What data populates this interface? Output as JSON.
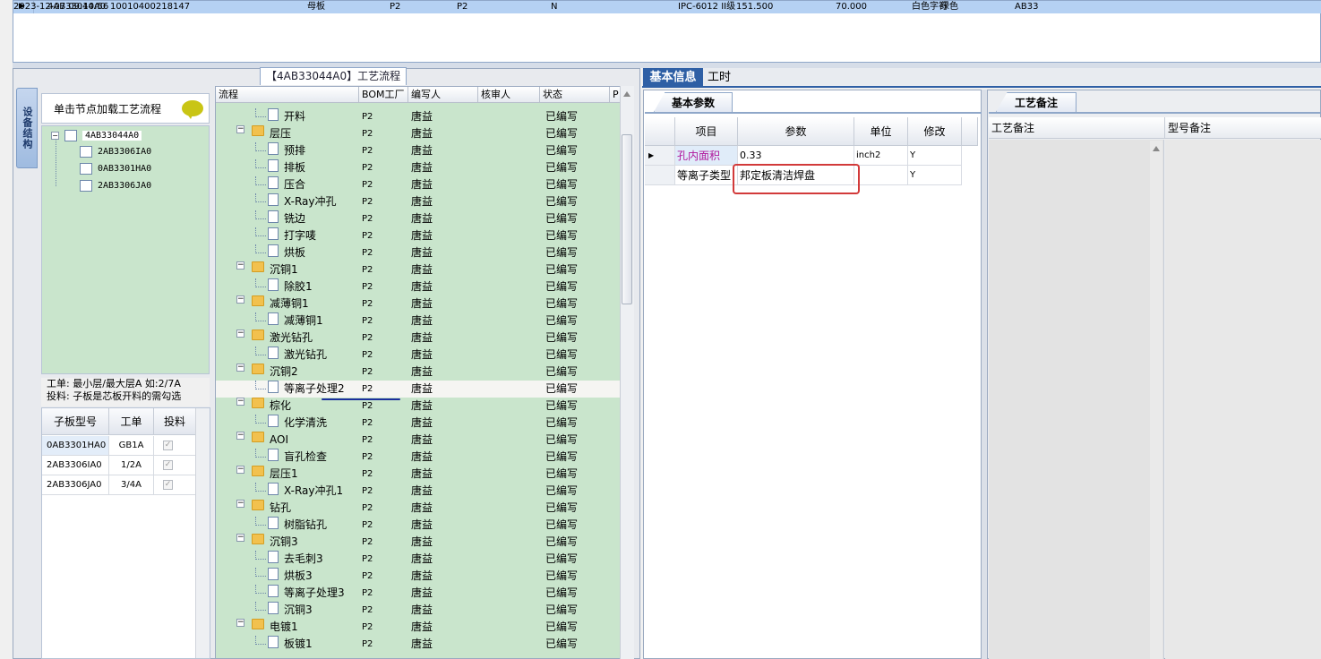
{
  "top_row": {
    "indicator": "▶",
    "cells": [
      "4AB33044A0",
      "10010400218147",
      "母板",
      "P2",
      "P2",
      "N",
      "IPC-6012 II级",
      "151.500",
      "70.000",
      "白色字符",
      "绿色",
      "AB33",
      "2023-12-07 09:10:56"
    ]
  },
  "left_panel": {
    "title": "【4AB33044A0】工艺流程",
    "vertical_tab": "设备结构",
    "tip": "单击节点加载工艺流程",
    "tree": {
      "root": "4AB33044A0",
      "children": [
        "2AB3306IA0",
        "0AB3301HA0",
        "2AB3306JA0"
      ]
    },
    "hint_line1": "工单: 最小层/最大层A 如:2/7A",
    "hint_line2": "投料: 子板是芯板开料的需勾选",
    "subboard_grid": {
      "headers": [
        "子板型号",
        "工单",
        "投料"
      ],
      "rows": [
        {
          "model": "0AB3301HA0",
          "order": "GB1A",
          "feed": true
        },
        {
          "model": "2AB3306IA0",
          "order": "1/2A",
          "feed": true
        },
        {
          "model": "2AB3306JA0",
          "order": "3/4A",
          "feed": true
        }
      ]
    }
  },
  "process_grid": {
    "headers": [
      "流程",
      "BOM工厂",
      "编写人",
      "核审人",
      "状态",
      "P"
    ],
    "rows": [
      {
        "level": 2,
        "name": "开料",
        "bom": "P2",
        "author": "唐益",
        "status": "已编写"
      },
      {
        "level": 1,
        "name": "层压",
        "bom": "P2",
        "author": "唐益",
        "status": "已编写"
      },
      {
        "level": 2,
        "name": "预排",
        "bom": "P2",
        "author": "唐益",
        "status": "已编写"
      },
      {
        "level": 2,
        "name": "排板",
        "bom": "P2",
        "author": "唐益",
        "status": "已编写"
      },
      {
        "level": 2,
        "name": "压合",
        "bom": "P2",
        "author": "唐益",
        "status": "已编写"
      },
      {
        "level": 2,
        "name": "X-Ray冲孔",
        "bom": "P2",
        "author": "唐益",
        "status": "已编写"
      },
      {
        "level": 2,
        "name": "铣边",
        "bom": "P2",
        "author": "唐益",
        "status": "已编写"
      },
      {
        "level": 2,
        "name": "打字唛",
        "bom": "P2",
        "author": "唐益",
        "status": "已编写"
      },
      {
        "level": 2,
        "name": "烘板",
        "bom": "P2",
        "author": "唐益",
        "status": "已编写"
      },
      {
        "level": 1,
        "name": "沉铜1",
        "bom": "P2",
        "author": "唐益",
        "status": "已编写"
      },
      {
        "level": 2,
        "name": "除胶1",
        "bom": "P2",
        "author": "唐益",
        "status": "已编写"
      },
      {
        "level": 1,
        "name": "减薄铜1",
        "bom": "P2",
        "author": "唐益",
        "status": "已编写"
      },
      {
        "level": 2,
        "name": "减薄铜1",
        "bom": "P2",
        "author": "唐益",
        "status": "已编写"
      },
      {
        "level": 1,
        "name": "激光钻孔",
        "bom": "P2",
        "author": "唐益",
        "status": "已编写"
      },
      {
        "level": 2,
        "name": "激光钻孔",
        "bom": "P2",
        "author": "唐益",
        "status": "已编写"
      },
      {
        "level": 1,
        "name": "沉铜2",
        "bom": "P2",
        "author": "唐益",
        "status": "已编写"
      },
      {
        "level": 2,
        "name": "等离子处理2",
        "bom": "P2",
        "author": "唐益",
        "status": "已编写",
        "selected": true
      },
      {
        "level": 1,
        "name": "棕化",
        "bom": "P2",
        "author": "唐益",
        "status": "已编写"
      },
      {
        "level": 2,
        "name": "化学清洗",
        "bom": "P2",
        "author": "唐益",
        "status": "已编写"
      },
      {
        "level": 1,
        "name": "AOI",
        "bom": "P2",
        "author": "唐益",
        "status": "已编写"
      },
      {
        "level": 2,
        "name": "盲孔检查",
        "bom": "P2",
        "author": "唐益",
        "status": "已编写"
      },
      {
        "level": 1,
        "name": "层压1",
        "bom": "P2",
        "author": "唐益",
        "status": "已编写"
      },
      {
        "level": 2,
        "name": "X-Ray冲孔1",
        "bom": "P2",
        "author": "唐益",
        "status": "已编写"
      },
      {
        "level": 1,
        "name": "钻孔",
        "bom": "P2",
        "author": "唐益",
        "status": "已编写"
      },
      {
        "level": 2,
        "name": "树脂钻孔",
        "bom": "P2",
        "author": "唐益",
        "status": "已编写"
      },
      {
        "level": 1,
        "name": "沉铜3",
        "bom": "P2",
        "author": "唐益",
        "status": "已编写"
      },
      {
        "level": 2,
        "name": "去毛刺3",
        "bom": "P2",
        "author": "唐益",
        "status": "已编写"
      },
      {
        "level": 2,
        "name": "烘板3",
        "bom": "P2",
        "author": "唐益",
        "status": "已编写"
      },
      {
        "level": 2,
        "name": "等离子处理3",
        "bom": "P2",
        "author": "唐益",
        "status": "已编写"
      },
      {
        "level": 2,
        "name": "沉铜3",
        "bom": "P2",
        "author": "唐益",
        "status": "已编写"
      },
      {
        "level": 1,
        "name": "电镀1",
        "bom": "P2",
        "author": "唐益",
        "status": "已编写"
      },
      {
        "level": 2,
        "name": "板镀1",
        "bom": "P2",
        "author": "唐益",
        "status": "已编写"
      }
    ]
  },
  "right_tabs": {
    "basic": "基本信息",
    "hours": "工时"
  },
  "params": {
    "tab": "基本参数",
    "headers": [
      "项目",
      "参数",
      "单位",
      "修改"
    ],
    "rows": [
      {
        "item": "孔内面积",
        "value": "0.33",
        "unit": "inch2",
        "modify": "Y",
        "current": true
      },
      {
        "item": "等离子类型",
        "value": "邦定板清洁焊盘",
        "unit": "",
        "modify": "Y"
      }
    ]
  },
  "notes": {
    "tab": "工艺备注",
    "col1": "工艺备注",
    "col2": "型号备注"
  },
  "colors": {
    "accent": "#2e5fa5",
    "tree_bg": "#c9e5cc",
    "top_row_bg": "#b5d1f3",
    "highlight": "#d23a3a"
  }
}
